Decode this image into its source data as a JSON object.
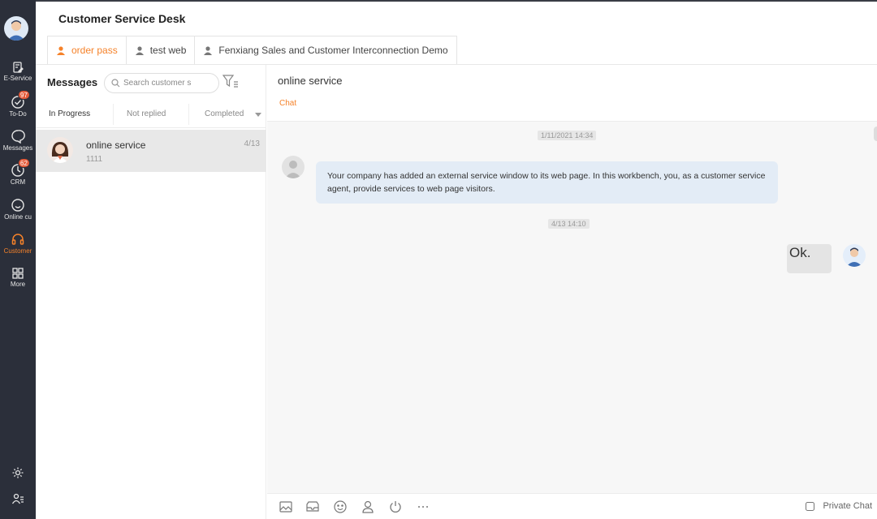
{
  "app": {
    "title": "Customer Service Desk"
  },
  "tabs": [
    {
      "label": "order pass",
      "active": true
    },
    {
      "label": "test web",
      "active": false
    },
    {
      "label": "Fenxiang Sales and Customer Interconnection Demo",
      "active": false
    }
  ],
  "rail": {
    "items": [
      {
        "label": "E-Service",
        "icon": "document-edit-icon",
        "badge": ""
      },
      {
        "label": "To-Do",
        "icon": "check-circle-icon",
        "badge": "97"
      },
      {
        "label": "Messages",
        "icon": "chat-bubble-icon",
        "badge": ""
      },
      {
        "label": "CRM",
        "icon": "crm-icon",
        "badge": "62"
      },
      {
        "label": "Online cu",
        "icon": "smile-icon",
        "badge": ""
      },
      {
        "label": "Customer",
        "icon": "headset-icon",
        "badge": "",
        "active": true
      },
      {
        "label": "More",
        "icon": "grid-icon",
        "badge": ""
      }
    ],
    "bottom": [
      "settings-icon",
      "user-list-icon"
    ]
  },
  "messages": {
    "title": "Messages",
    "search_placeholder": "Search customer s",
    "subtabs": [
      "In Progress",
      "Not replied",
      "Completed"
    ],
    "conversations": [
      {
        "name": "online service",
        "preview": "1111",
        "date": "4/13"
      }
    ]
  },
  "chat": {
    "title": "online service",
    "tab": "Chat",
    "messages": [
      {
        "time": "1/11/2021 14:34"
      },
      {
        "direction": "in",
        "text": "Your company has added an external service window to its web page. In this workbench, you, as a customer service agent, provide services to web page visitors."
      },
      {
        "time": "4/13 14:10"
      },
      {
        "direction": "out",
        "text": "Ok."
      }
    ],
    "toolbar": [
      "image-icon",
      "folder-icon",
      "emoji-icon",
      "transfer-agent-icon",
      "power-icon",
      "more-icon"
    ],
    "private_chat_label": "Private Chat"
  },
  "colors": {
    "accent": "#f5822a",
    "rail_bg": "#2b2f3a",
    "bubble_in": "#e3ecf6",
    "badge": "#e35b3a"
  }
}
